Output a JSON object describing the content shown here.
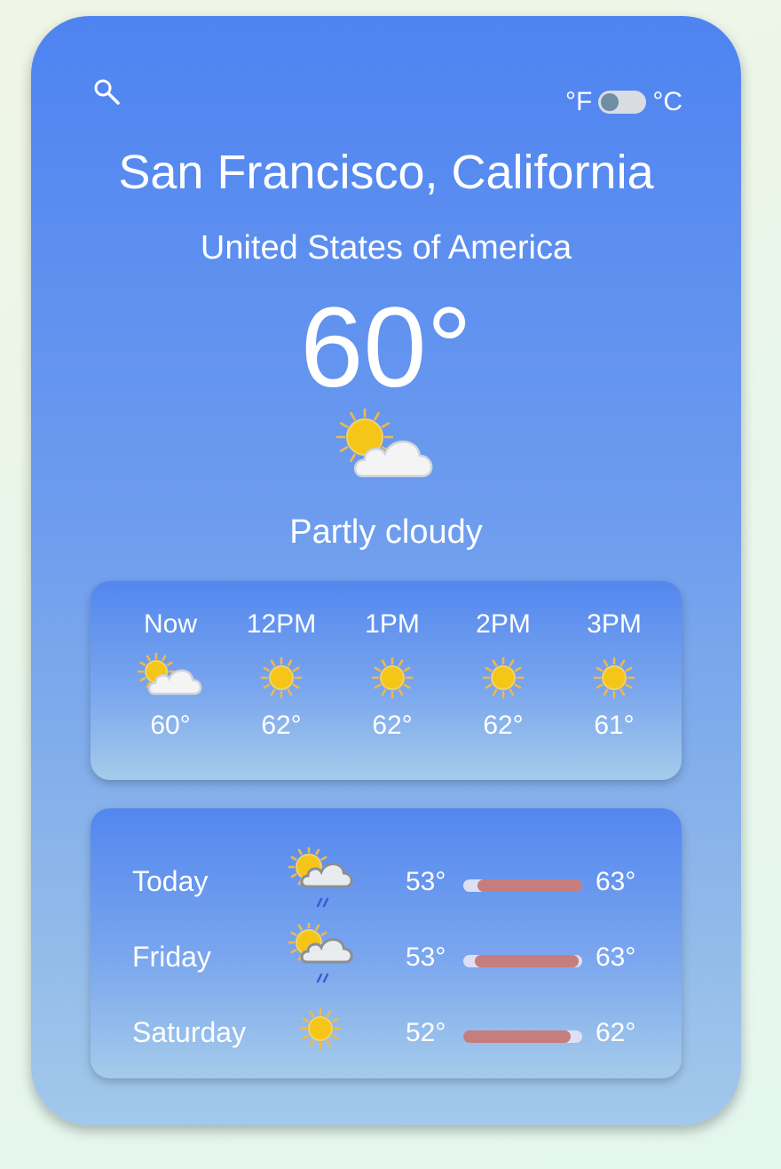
{
  "header": {
    "search_icon": "search-icon",
    "unit_left": "°F",
    "unit_right": "°C"
  },
  "location": {
    "city": "San Francisco, California",
    "country": "United States of America"
  },
  "current": {
    "temperature": "60°",
    "condition": "Partly cloudy",
    "icon": "partly-cloudy-icon"
  },
  "hourly": [
    {
      "label": "Now",
      "icon": "partly-cloudy-icon",
      "temp": "60°"
    },
    {
      "label": "12PM",
      "icon": "sun-icon",
      "temp": "62°"
    },
    {
      "label": "1PM",
      "icon": "sun-icon",
      "temp": "62°"
    },
    {
      "label": "2PM",
      "icon": "sun-icon",
      "temp": "62°"
    },
    {
      "label": "3PM",
      "icon": "sun-icon",
      "temp": "61°"
    }
  ],
  "daily": [
    {
      "name": "Today",
      "icon": "rain-partly-cloudy-icon",
      "low": "53°",
      "high": "63°",
      "range_start": 0.12,
      "range_end": 1.0
    },
    {
      "name": "Friday",
      "icon": "rain-partly-cloudy-icon",
      "low": "53°",
      "high": "63°",
      "range_start": 0.1,
      "range_end": 0.97
    },
    {
      "name": "Saturday",
      "icon": "sun-icon",
      "low": "52°",
      "high": "62°",
      "range_start": 0.0,
      "range_end": 0.9
    }
  ],
  "colors": {
    "range_fill": "#c67d7d",
    "range_track": "#dde0f4",
    "sun": "#f5c518",
    "sun_ray": "#f0b84a",
    "cloud": "#f4f4f4"
  }
}
